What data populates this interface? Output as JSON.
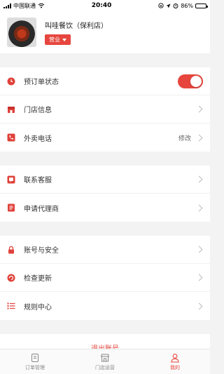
{
  "status_bar": {
    "carrier": "中国联通",
    "time": "20:40",
    "battery": "86%",
    "battery_level": 0.86
  },
  "store": {
    "name": "叫哇餐饮（保利店）",
    "status": "营业"
  },
  "settings": {
    "reservation": {
      "label": "预订单状态",
      "enabled": true
    },
    "store_info": {
      "label": "门店信息"
    },
    "takeout_phone": {
      "label": "外卖电话",
      "action": "修改"
    },
    "customer_service": {
      "label": "联系客服"
    },
    "apply_agent": {
      "label": "申请代理商"
    },
    "account_security": {
      "label": "账号与安全"
    },
    "check_update": {
      "label": "检查更新"
    },
    "rules_center": {
      "label": "规则中心"
    },
    "logout": {
      "label": "退出账号"
    }
  },
  "tabbar": {
    "items": [
      {
        "label": "订单管理",
        "active": false
      },
      {
        "label": "门店运营",
        "active": false
      },
      {
        "label": "我的",
        "active": true
      }
    ]
  },
  "colors": {
    "accent": "#e6463d",
    "background": "#f3f3f3"
  }
}
